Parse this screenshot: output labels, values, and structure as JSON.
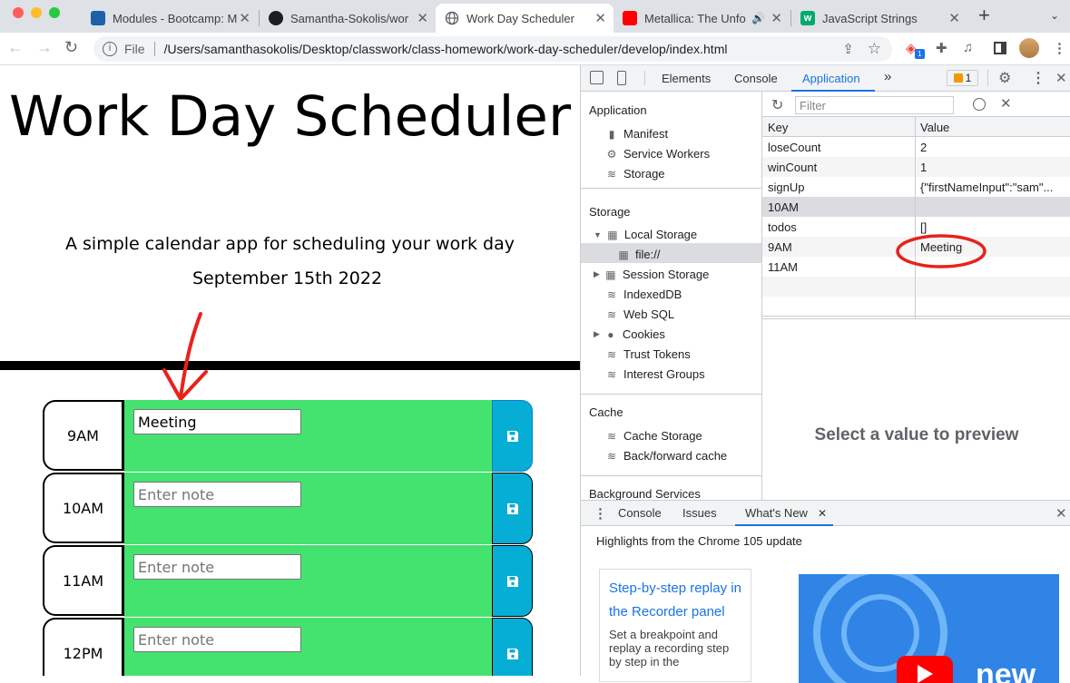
{
  "browser": {
    "tabs": [
      {
        "title": "Modules - Bootcamp: M",
        "active": false
      },
      {
        "title": "Samantha-Sokolis/work",
        "active": false
      },
      {
        "title": "Work Day Scheduler",
        "active": true
      },
      {
        "title": "Metallica: The Unfo",
        "active": false
      },
      {
        "title": "JavaScript Strings",
        "active": false
      }
    ],
    "new_tab": "+",
    "file_label": "File",
    "url": "/Users/samanthasokolis/Desktop/classwork/class-homework/work-day-scheduler/develop/index.html",
    "extension_badge": "1"
  },
  "page": {
    "title": "Work Day Scheduler",
    "lead": "A simple calendar app for scheduling your work day",
    "current_day": "September 15th 2022",
    "rows": [
      {
        "hour": "9AM",
        "value": "Meeting",
        "placeholder": "Enter note"
      },
      {
        "hour": "10AM",
        "value": "",
        "placeholder": "Enter note"
      },
      {
        "hour": "11AM",
        "value": "",
        "placeholder": "Enter note"
      },
      {
        "hour": "12PM",
        "value": "",
        "placeholder": "Enter note"
      }
    ]
  },
  "devtools": {
    "tabs": [
      "Elements",
      "Console",
      "Application",
      "»"
    ],
    "issues_count": "1",
    "sidebar": {
      "application_head": "Application",
      "application_items": [
        "Manifest",
        "Service Workers",
        "Storage"
      ],
      "storage_head": "Storage",
      "local_storage": "Local Storage",
      "local_storage_child": "file://",
      "session_storage": "Session Storage",
      "indexeddb": "IndexedDB",
      "websql": "Web SQL",
      "cookies": "Cookies",
      "trust_tokens": "Trust Tokens",
      "interest_groups": "Interest Groups",
      "cache_head": "Cache",
      "cache_storage": "Cache Storage",
      "bf_cache": "Back/forward cache",
      "bg_services_head": "Background Services"
    },
    "filter_placeholder": "Filter",
    "table": {
      "key_header": "Key",
      "value_header": "Value",
      "rows": [
        {
          "key": "loseCount",
          "value": "2"
        },
        {
          "key": "winCount",
          "value": "1"
        },
        {
          "key": "signUp",
          "value": "{\"firstNameInput\":\"sam\"..."
        },
        {
          "key": "10AM",
          "value": ""
        },
        {
          "key": "todos",
          "value": "[]"
        },
        {
          "key": "9AM",
          "value": "Meeting"
        },
        {
          "key": "11AM",
          "value": ""
        }
      ]
    },
    "preview_text": "Select a value to preview",
    "drawer": {
      "tabs": [
        "Console",
        "Issues",
        "What's New"
      ],
      "heading": "Highlights from the Chrome 105 update",
      "card_link": "Step-by-step replay in the Recorder panel",
      "card_body": "Set a breakpoint and replay a recording step by step in the",
      "promo_text": "new"
    }
  },
  "colors": {
    "note_bg": "#44e36f",
    "save_bg": "#06aed5",
    "annotation_red": "#e8221b"
  }
}
